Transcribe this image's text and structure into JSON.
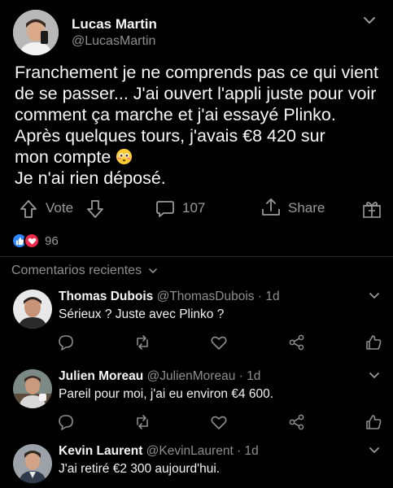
{
  "post": {
    "author_name": "Lucas Martin",
    "author_handle": "@LucasMartin",
    "body_lines": [
      "Franchement je ne comprends pas ce qui vient",
      "de se passer... J'ai ouvert l'appli juste pour voir",
      "comment ça marche et j'ai essayé Plinko.",
      "Après quelques tours, j'avais €8 420 sur",
      "mon compte",
      "Je n'ai rien déposé."
    ],
    "vote_label": "Vote",
    "comment_count": "107",
    "share_label": "Share",
    "reaction_count": "96"
  },
  "comments_section": {
    "sort_label": "Comentarios recientes"
  },
  "comments": [
    {
      "name": "Thomas Dubois",
      "handle": "@ThomasDubois · 1d",
      "text": "Sérieux ? Juste avec Plinko ?"
    },
    {
      "name": "Julien Moreau",
      "handle": "@JulienMoreau · 1d",
      "text": "Pareil pour moi, j'ai eu environ €4 600."
    },
    {
      "name": "Kevin Laurent",
      "handle": "@KevinLaurent · 1d",
      "text": "J'ai retiré €2 300 aujourd'hui."
    }
  ],
  "colors": {
    "background": "#000000",
    "text": "#f2f2f2",
    "muted": "#8e8e8e",
    "like": "#2d86ff",
    "love": "#f0284a"
  },
  "icons": [
    "chevron-down-icon",
    "arrow-up-icon",
    "arrow-down-icon",
    "comment-icon",
    "share-icon",
    "gift-icon",
    "like-icon",
    "heart-icon",
    "retweet-icon",
    "network-share-icon",
    "thumbs-up-icon",
    "flushed-face-emoji"
  ]
}
